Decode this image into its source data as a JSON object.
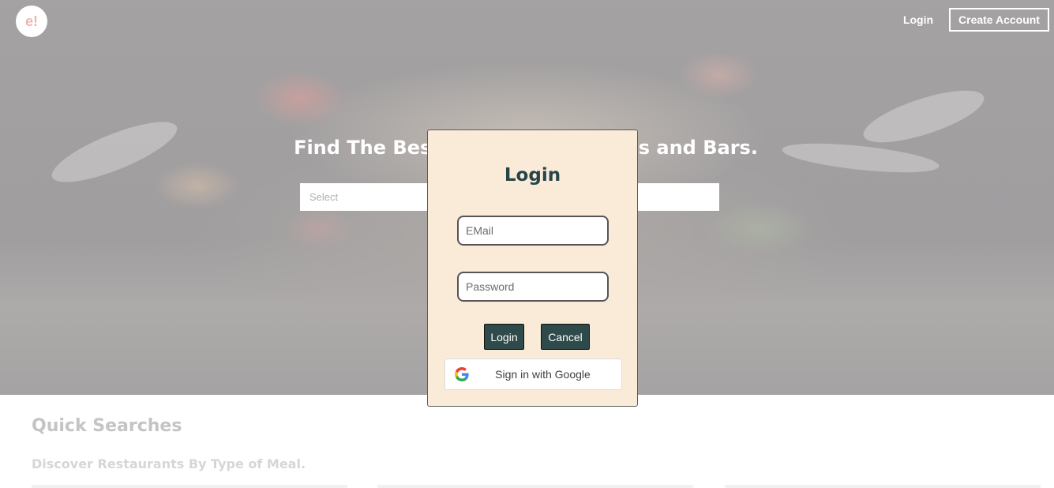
{
  "header": {
    "logo_text": "e!",
    "login_label": "Login",
    "create_account_label": "Create Account"
  },
  "hero": {
    "heading": "Find The Best Restaurants, Cafés and Bars.",
    "select_placeholder": "Select"
  },
  "quick_searches": {
    "title": "Quick Searches",
    "subtitle": "Discover Restaurants By Type of Meal."
  },
  "login_modal": {
    "title": "Login",
    "email_placeholder": "EMail",
    "password_placeholder": "Password",
    "login_button": "Login",
    "cancel_button": "Cancel",
    "google_button": "Sign in with Google"
  },
  "colors": {
    "modal_background": "#faebd9",
    "button_primary": "#2e4a4a",
    "title_color": "#274448"
  }
}
